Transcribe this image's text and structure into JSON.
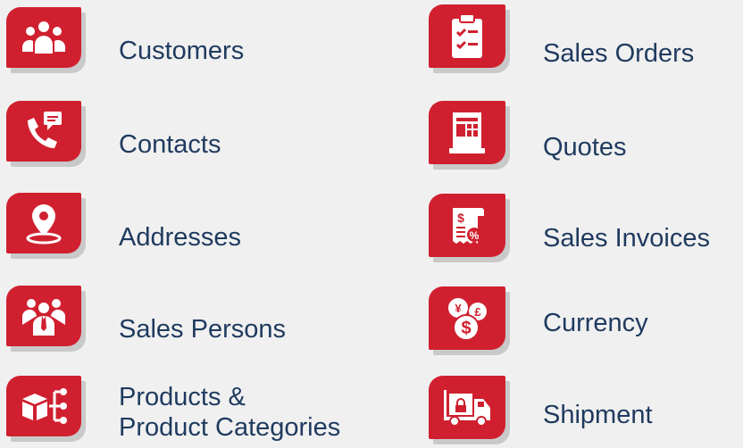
{
  "left": [
    {
      "label": "Customers",
      "icon": "people-group-icon"
    },
    {
      "label": "Contacts",
      "icon": "phone-message-icon"
    },
    {
      "label": "Addresses",
      "icon": "location-pin-icon"
    },
    {
      "label": "Sales Persons",
      "icon": "sales-team-icon"
    },
    {
      "label_line1": "Products &",
      "label_line2": "Product Categories",
      "icon": "product-hierarchy-icon"
    }
  ],
  "right": [
    {
      "label": "Sales Orders",
      "icon": "clipboard-checklist-icon"
    },
    {
      "label": "Quotes",
      "icon": "receipt-printer-icon"
    },
    {
      "label": "Sales Invoices",
      "icon": "invoice-percent-icon"
    },
    {
      "label": "Currency",
      "icon": "currency-coins-icon"
    },
    {
      "label": "Shipment",
      "icon": "delivery-truck-icon"
    }
  ],
  "colors": {
    "tile": "#d0202f",
    "label": "#1f3a5f",
    "background": "#f0f0f0"
  }
}
